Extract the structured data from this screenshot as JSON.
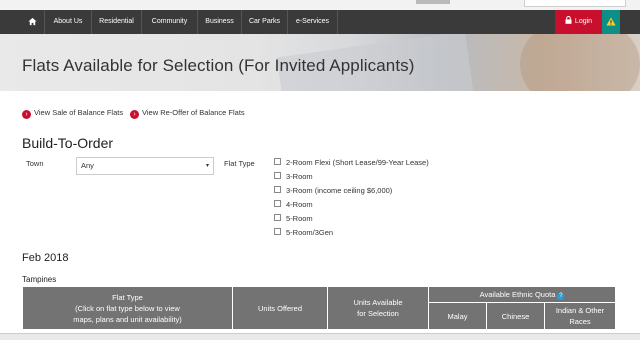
{
  "nav": {
    "items": [
      "About Us",
      "Residential",
      "Community",
      "Business",
      "Car Parks",
      "e-Services"
    ],
    "login_label": "Login"
  },
  "hero": {
    "title": "Flats Available for Selection (For Invited Applicants)"
  },
  "links": {
    "sale_of_balance": "View Sale of Balance Flats",
    "re_offer": "View Re-Offer of Balance Flats"
  },
  "bto": {
    "heading": "Build-To-Order",
    "town_label": "Town",
    "town_value": "Any",
    "flat_type_label": "Flat Type",
    "flat_types": [
      "2-Room Flexi (Short Lease/99-Year Lease)",
      "3-Room",
      "3-Room (income ceiling $6,000)",
      "4-Room",
      "5-Room",
      "5-Room/3Gen"
    ]
  },
  "listing": {
    "month": "Feb 2018",
    "estate": "Tampines",
    "table": {
      "flat_type_header_line1": "Flat Type",
      "flat_type_header_line2": "(Click on flat type below to view",
      "flat_type_header_line3": "maps, plans and unit availability)",
      "units_offered": "Units Offered",
      "units_available_line1": "Units Available",
      "units_available_line2": "for Selection",
      "ethnic_quota": "Available Ethnic Quota",
      "ethnic_columns": [
        "Malay",
        "Chinese",
        "Indian & Other Races"
      ]
    }
  },
  "colors": {
    "nav_bg": "#3a3a3a",
    "login_bg": "#c8102e",
    "alert_bg": "#0e8f86",
    "table_header": "#737373"
  }
}
